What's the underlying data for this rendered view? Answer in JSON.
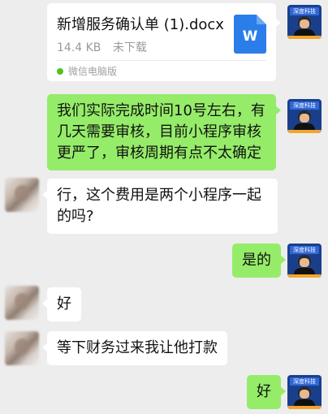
{
  "file_card": {
    "name": "新增服务确认单 (1).docx",
    "size": "14.4 KB",
    "status": "未下载",
    "source": "微信电脑版",
    "file_icon_letter": "W"
  },
  "avatars": {
    "self_badge": "深度科技"
  },
  "messages": [
    {
      "sender": "self",
      "text": "我们实际完成时间10号左右，有几天需要审核，目前小程序审核更严了，审核周期有点不太确定"
    },
    {
      "sender": "other",
      "text": "行，这个费用是两个小程序一起的吗?"
    },
    {
      "sender": "self",
      "text": "是的"
    },
    {
      "sender": "other",
      "text": "好"
    },
    {
      "sender": "other",
      "text": "等下财务过来我让他打款"
    },
    {
      "sender": "self",
      "text": "好"
    }
  ],
  "colors": {
    "self_bubble": "#95ec69",
    "other_bubble": "#ffffff",
    "background": "#ededed"
  }
}
